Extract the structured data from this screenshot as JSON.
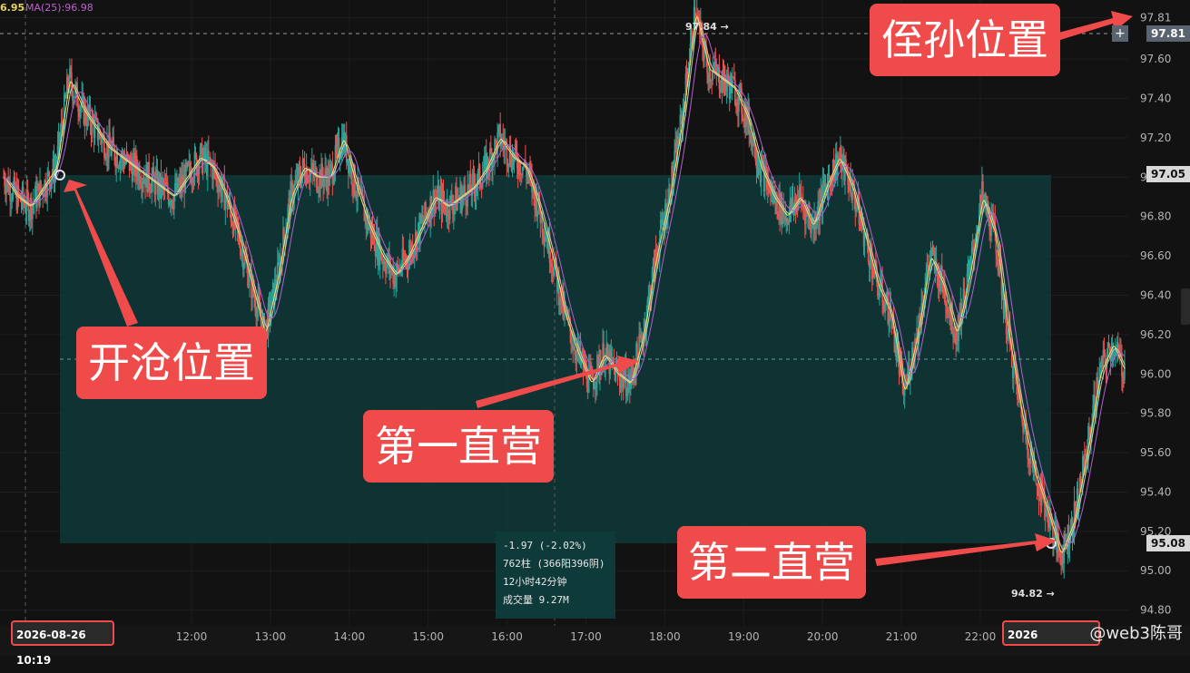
{
  "ma_legend": {
    "prefix_value": "6.95",
    "ma25_label": "MA(25):96.98"
  },
  "price_tags": {
    "stop": "97.81",
    "entry": "97.05",
    "low": "95.08"
  },
  "annotations": {
    "high_point": "97.84 →",
    "low_point": "94.82 →"
  },
  "callouts": {
    "stop_loss": "侄孙位置",
    "entry": "开沧位置",
    "first_stop": "第一直营",
    "second_stop": "第二直营"
  },
  "stats": {
    "change": "-1.97 (-2.02%)",
    "bars": "762柱 (366阳396阴)",
    "duration": "12小时42分钟",
    "volume": "成交量 9.27M"
  },
  "date_boxes": {
    "start": "2026-08-26 10:19",
    "end": "2026"
  },
  "watermark": "@web3陈哥",
  "colors": {
    "up": "#26a69a",
    "down": "#ef5350",
    "ma_fast": "#f5e663",
    "ma_mid": "#c8c8c8",
    "ma_slow": "#b060d0",
    "zone": "#0f3a3a",
    "callout": "#ef4b4b"
  },
  "chart_data": {
    "type": "line",
    "x_ticks": [
      "12:00",
      "13:00",
      "14:00",
      "15:00",
      "16:00",
      "17:00",
      "18:00",
      "19:00",
      "20:00",
      "21:00",
      "22:00"
    ],
    "y_ticks": [
      "94.80",
      "95.00",
      "95.20",
      "95.40",
      "95.60",
      "95.80",
      "96.00",
      "96.20",
      "96.40",
      "96.60",
      "96.80",
      "97.00",
      "97.20",
      "97.40",
      "97.60",
      "97.81"
    ],
    "ylim": [
      94.72,
      97.9
    ],
    "series": [
      {
        "values": [
          97.0,
          96.9,
          96.85,
          96.95,
          97.05,
          97.5,
          97.35,
          97.25,
          97.15,
          97.1,
          97.05,
          97.0,
          96.95,
          96.9,
          97.0,
          97.1,
          97.05,
          96.9,
          96.7,
          96.45,
          96.2,
          96.5,
          96.9,
          97.05,
          97.0,
          97.0,
          97.2,
          96.95,
          96.75,
          96.6,
          96.5,
          96.6,
          96.75,
          96.9,
          96.85,
          96.9,
          96.95,
          97.05,
          97.2,
          97.1,
          97.05,
          96.85,
          96.6,
          96.3,
          96.1,
          95.95,
          96.1,
          96.0,
          95.95,
          96.2,
          96.6,
          96.9,
          97.3,
          97.84,
          97.55,
          97.5,
          97.45,
          97.3,
          97.05,
          96.9,
          96.8,
          96.9,
          96.75,
          96.95,
          97.1,
          96.95,
          96.7,
          96.45,
          96.3,
          95.9,
          96.2,
          96.6,
          96.45,
          96.2,
          96.5,
          96.9,
          96.7,
          96.2,
          95.8,
          95.5,
          95.3,
          95.08,
          95.25,
          95.6,
          96.0,
          96.15,
          96.0
        ]
      }
    ]
  }
}
